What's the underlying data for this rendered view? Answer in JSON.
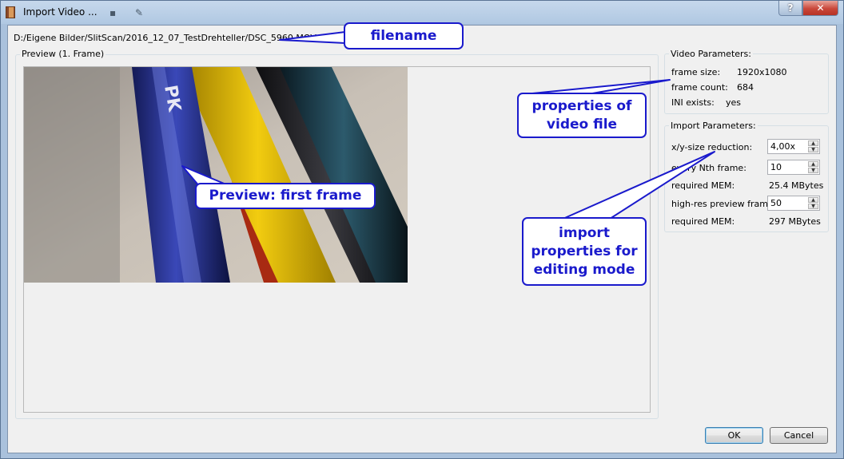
{
  "window": {
    "title": "Import Video ...",
    "help_label": "?",
    "close_label": "✕"
  },
  "file": {
    "path": "D:/Eigene Bilder/SlitScan/2016_12_07_TestDrehteller/DSC_5960.MOV"
  },
  "preview": {
    "group_title": "Preview (1. Frame)"
  },
  "video_params": {
    "title": "Video Parameters:",
    "frame_size_label": "frame size:",
    "frame_size_value": "1920x1080",
    "frame_count_label": "frame count:",
    "frame_count_value": "684",
    "ini_label": "INI exists:",
    "ini_value": "yes"
  },
  "import_params": {
    "title": "Import Parameters:",
    "reduction_label": "x/y-size reduction:",
    "reduction_value": "4,00x",
    "nth_frame_label": "every Nth frame:",
    "nth_frame_value": "10",
    "mem1_label": "required MEM:",
    "mem1_value": "25.4 MBytes",
    "hires_label": "high-res preview frames",
    "hires_value": "50",
    "mem2_label": "required MEM:",
    "mem2_value": "297 MBytes"
  },
  "buttons": {
    "ok": "OK",
    "cancel": "Cancel"
  },
  "callouts": {
    "filename": "filename",
    "video_props_line1": "properties of",
    "video_props_line2": "video file",
    "preview": "Preview: first frame",
    "import_line1": "import",
    "import_line2": "properties for",
    "import_line3": "editing mode"
  },
  "colors": {
    "callout": "#1a1acc",
    "dialog_bg": "#f0f0f0",
    "titlebar": "#b9cfe6"
  }
}
